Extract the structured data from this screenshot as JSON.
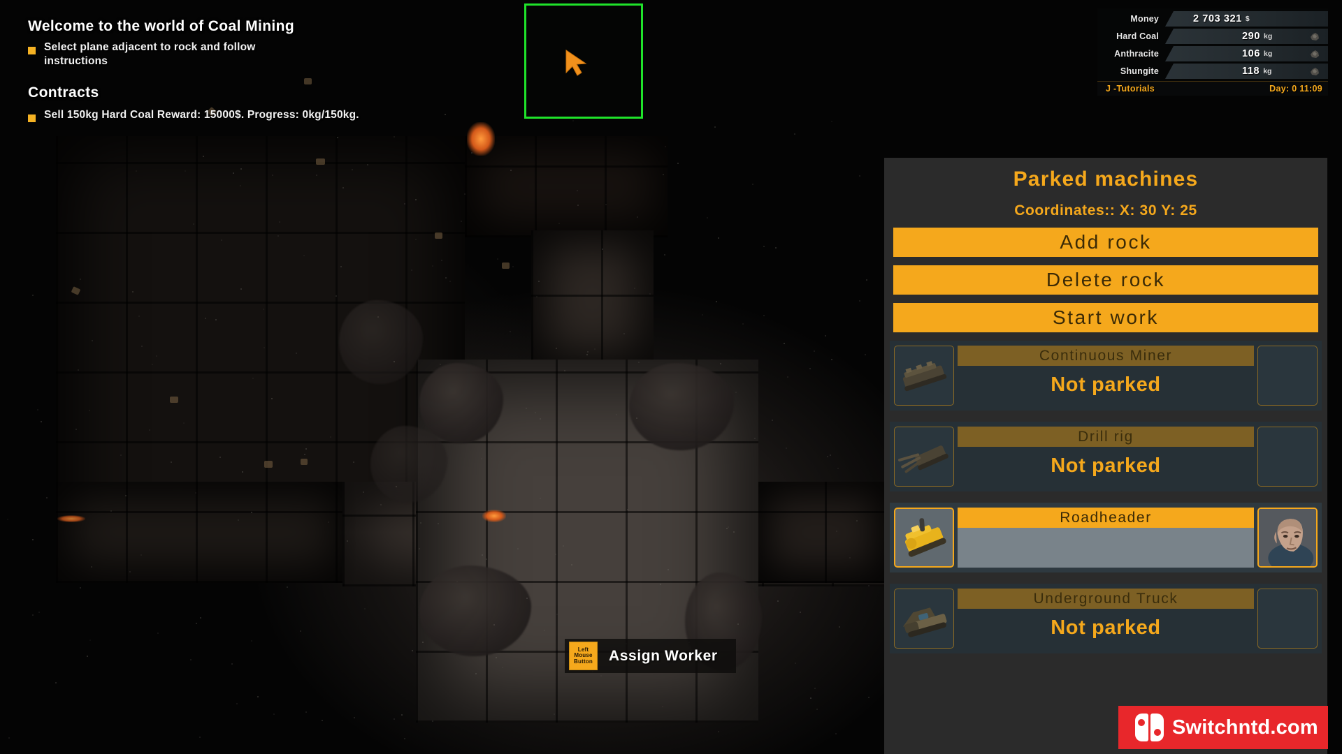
{
  "tutorial": {
    "welcome_heading": "Welcome to the world of Coal Mining",
    "welcome_item": "Select plane adjacent to rock and follow instructions",
    "contracts_heading": "Contracts",
    "contract_item": "Sell 150kg Hard Coal Reward: 15000$. Progress: 0kg/150kg."
  },
  "hud": {
    "rows": [
      {
        "label": "Money",
        "value": "2 703 321",
        "unit": "$",
        "icon": "coin-icon"
      },
      {
        "label": "Hard Coal",
        "value": "290",
        "unit": "kg",
        "icon": "hard-coal-icon"
      },
      {
        "label": "Anthracite",
        "value": "106",
        "unit": "kg",
        "icon": "anthracite-icon"
      },
      {
        "label": "Shungite",
        "value": "118",
        "unit": "kg",
        "icon": "shungite-icon"
      }
    ],
    "tutorials_hint": "J -Tutorials",
    "day_time": "Day: 0 11:09"
  },
  "panel": {
    "title": "Parked machines",
    "coordinates": "Coordinates:: X: 30 Y: 25",
    "buttons": [
      {
        "label": "Add rock",
        "name": "add-rock-button"
      },
      {
        "label": "Delete rock",
        "name": "delete-rock-button"
      },
      {
        "label": "Start work",
        "name": "start-work-button"
      }
    ],
    "machines": [
      {
        "name": "Continuous Miner",
        "status": "Not parked",
        "active": false,
        "has_worker": false
      },
      {
        "name": "Drill rig",
        "status": "Not parked",
        "active": false,
        "has_worker": false
      },
      {
        "name": "Roadheader",
        "status": "",
        "active": true,
        "has_worker": true
      },
      {
        "name": "Underground Truck",
        "status": "Not parked",
        "active": false,
        "has_worker": false
      }
    ]
  },
  "tooltip": {
    "key_line1": "Left",
    "key_line2": "Mouse",
    "key_line3": "Button",
    "action_label": "Assign Worker"
  },
  "watermark": {
    "text": "Switchntd.com"
  },
  "colors": {
    "accent_orange": "#f5a81c",
    "selection_green": "#1fe32a",
    "panel_bg": "#2b2b2b",
    "row_bg": "#263036",
    "watermark_red": "#e8272b"
  }
}
